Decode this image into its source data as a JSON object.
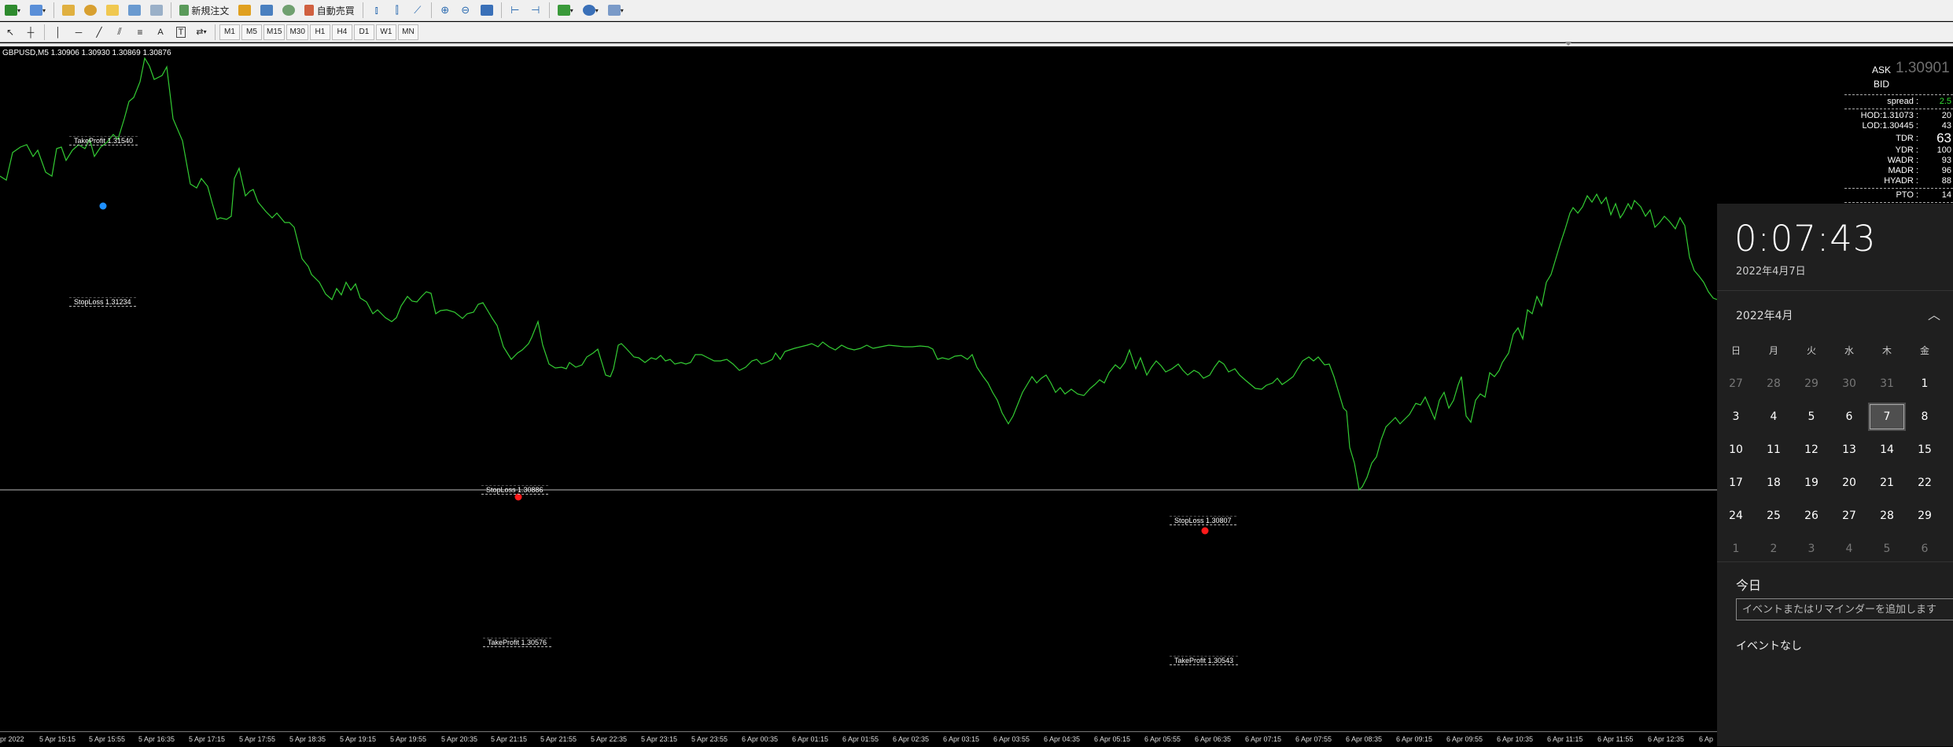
{
  "toolbar": {
    "new_order_label": "新規注文",
    "autotrade_label": "自動売買",
    "timeframes": [
      "M1",
      "M5",
      "M15",
      "M30",
      "H1",
      "H4",
      "D1",
      "W1",
      "MN"
    ]
  },
  "chart": {
    "symbol_info": "GBPUSD,M5  1.30906 1.30930 1.30869 1.30876",
    "line_color": "#33cc33",
    "orders": [
      {
        "label": "TakeProfit 1.31540",
        "type": "take-profit"
      },
      {
        "label": "StopLoss 1.31234",
        "type": "stop-loss"
      },
      {
        "label": "StopLoss 1.30886",
        "type": "stop-loss"
      },
      {
        "label": "TakeProfit 1.30576",
        "type": "take-profit"
      },
      {
        "label": "StopLoss 1.30807",
        "type": "stop-loss"
      },
      {
        "label": "TakeProfit 1.30543",
        "type": "take-profit"
      }
    ],
    "markers": [
      {
        "color": "#1e90ff",
        "kind": "buy"
      },
      {
        "color": "#ff1a1a",
        "kind": "sell"
      },
      {
        "color": "#ff1a1a",
        "kind": "sell"
      }
    ],
    "time_labels": [
      "pr 2022",
      "5 Apr 15:15",
      "5 Apr 15:55",
      "5 Apr 16:35",
      "5 Apr 17:15",
      "5 Apr 17:55",
      "5 Apr 18:35",
      "5 Apr 19:15",
      "5 Apr 19:55",
      "5 Apr 20:35",
      "5 Apr 21:15",
      "5 Apr 21:55",
      "5 Apr 22:35",
      "5 Apr 23:15",
      "5 Apr 23:55",
      "6 Apr 00:35",
      "6 Apr 01:15",
      "6 Apr 01:55",
      "6 Apr 02:35",
      "6 Apr 03:15",
      "6 Apr 03:55",
      "6 Apr 04:35",
      "6 Apr 05:15",
      "6 Apr 05:55",
      "6 Apr 06:35",
      "6 Apr 07:15",
      "6 Apr 07:55",
      "6 Apr 08:35",
      "6 Apr 09:15",
      "6 Apr 09:55",
      "6 Apr 10:35",
      "6 Apr 11:15",
      "6 Apr 11:55",
      "6 Apr 12:35",
      "6 Ap"
    ]
  },
  "info_panel": {
    "ask_label": "ASK",
    "ask_value": "1.30901",
    "bid_label": "BID",
    "spread_label": "spread :",
    "spread_value": "2.5",
    "hod": {
      "label": "HOD:1.31073 :",
      "value": "20"
    },
    "lod": {
      "label": "LOD:1.30445 :",
      "value": "43"
    },
    "tdr": {
      "label": "TDR :",
      "value": "63"
    },
    "ydr": {
      "label": "YDR :",
      "value": "100"
    },
    "wadr": {
      "label": "WADR :",
      "value": "93"
    },
    "madr": {
      "label": "MADR :",
      "value": "96"
    },
    "hyadr": {
      "label": "HYADR :",
      "value": "88"
    },
    "pto": {
      "label": "PTO :",
      "value": "14"
    }
  },
  "clock": {
    "time": "0:07:43",
    "date": "2022年4月7日",
    "month_title": "2022年4月",
    "weekdays": [
      "日",
      "月",
      "火",
      "水",
      "木",
      "金"
    ],
    "weeks": [
      [
        {
          "d": "27",
          "o": true
        },
        {
          "d": "28",
          "o": true
        },
        {
          "d": "29",
          "o": true
        },
        {
          "d": "30",
          "o": true
        },
        {
          "d": "31",
          "o": true
        },
        {
          "d": "1",
          "o": false
        }
      ],
      [
        {
          "d": "3",
          "o": false
        },
        {
          "d": "4",
          "o": false
        },
        {
          "d": "5",
          "o": false
        },
        {
          "d": "6",
          "o": false
        },
        {
          "d": "7",
          "o": false,
          "today": true
        },
        {
          "d": "8",
          "o": false
        }
      ],
      [
        {
          "d": "10",
          "o": false
        },
        {
          "d": "11",
          "o": false
        },
        {
          "d": "12",
          "o": false
        },
        {
          "d": "13",
          "o": false
        },
        {
          "d": "14",
          "o": false
        },
        {
          "d": "15",
          "o": false
        }
      ],
      [
        {
          "d": "17",
          "o": false
        },
        {
          "d": "18",
          "o": false
        },
        {
          "d": "19",
          "o": false
        },
        {
          "d": "20",
          "o": false
        },
        {
          "d": "21",
          "o": false
        },
        {
          "d": "22",
          "o": false
        }
      ],
      [
        {
          "d": "24",
          "o": false
        },
        {
          "d": "25",
          "o": false
        },
        {
          "d": "26",
          "o": false
        },
        {
          "d": "27",
          "o": false
        },
        {
          "d": "28",
          "o": false
        },
        {
          "d": "29",
          "o": false
        }
      ],
      [
        {
          "d": "1",
          "o": true
        },
        {
          "d": "2",
          "o": true
        },
        {
          "d": "3",
          "o": true
        },
        {
          "d": "4",
          "o": true
        },
        {
          "d": "5",
          "o": true
        },
        {
          "d": "6",
          "o": true
        }
      ]
    ],
    "today_label": "今日",
    "event_placeholder": "イベントまたはリマインダーを追加します",
    "no_event": "イベントなし"
  }
}
